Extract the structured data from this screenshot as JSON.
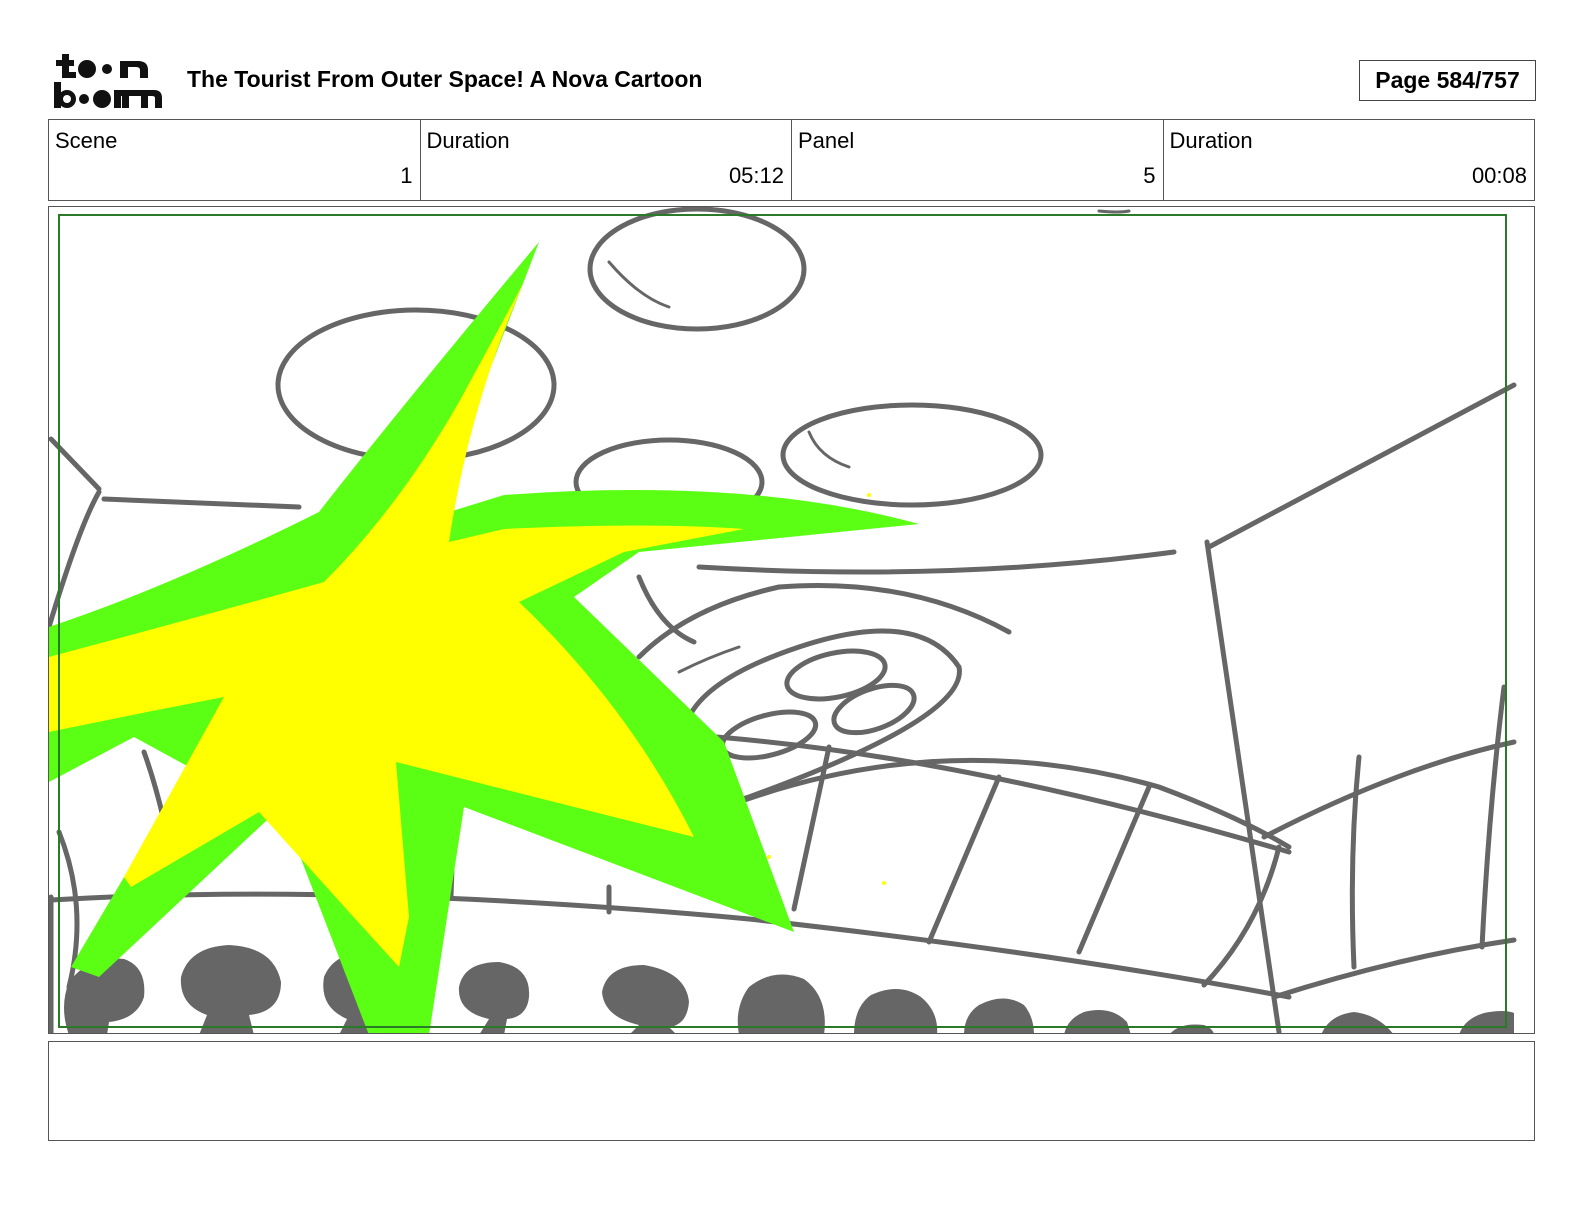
{
  "header": {
    "logo": {
      "name": "toon boom",
      "icon": "toon-boom-logo"
    },
    "title": "The Tourist From Outer Space!  A Nova Cartoon",
    "page_label": "Page 584/757"
  },
  "info": {
    "scene": {
      "label": "Scene",
      "value": "1"
    },
    "scene_duration": {
      "label": "Duration",
      "value": "05:12"
    },
    "panel": {
      "label": "Panel",
      "value": "5"
    },
    "panel_duration": {
      "label": "Duration",
      "value": "00:08"
    }
  },
  "panel_image": {
    "description_icon": "storyboard-sketch-drawing",
    "colors": {
      "sketch": "#666666",
      "flash_outer": "#5aff14",
      "flash_inner": "#ffff00",
      "safe_frame": "#2a7a2a"
    }
  },
  "notes": {
    "text": ""
  }
}
